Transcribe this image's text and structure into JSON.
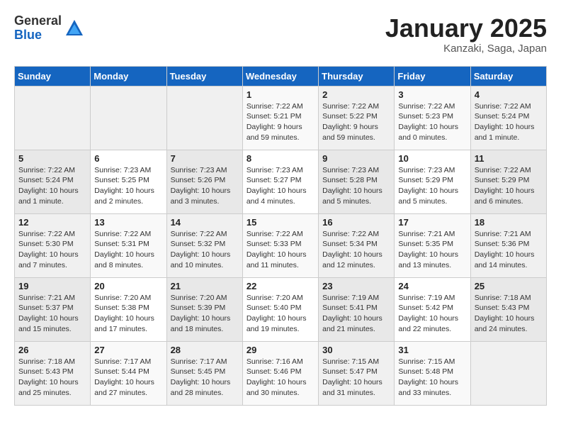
{
  "header": {
    "logo_general": "General",
    "logo_blue": "Blue",
    "title": "January 2025",
    "location": "Kanzaki, Saga, Japan"
  },
  "weekdays": [
    "Sunday",
    "Monday",
    "Tuesday",
    "Wednesday",
    "Thursday",
    "Friday",
    "Saturday"
  ],
  "weeks": [
    [
      {
        "num": "",
        "info": ""
      },
      {
        "num": "",
        "info": ""
      },
      {
        "num": "",
        "info": ""
      },
      {
        "num": "1",
        "info": "Sunrise: 7:22 AM\nSunset: 5:21 PM\nDaylight: 9 hours\nand 59 minutes."
      },
      {
        "num": "2",
        "info": "Sunrise: 7:22 AM\nSunset: 5:22 PM\nDaylight: 9 hours\nand 59 minutes."
      },
      {
        "num": "3",
        "info": "Sunrise: 7:22 AM\nSunset: 5:23 PM\nDaylight: 10 hours\nand 0 minutes."
      },
      {
        "num": "4",
        "info": "Sunrise: 7:22 AM\nSunset: 5:24 PM\nDaylight: 10 hours\nand 1 minute."
      }
    ],
    [
      {
        "num": "5",
        "info": "Sunrise: 7:22 AM\nSunset: 5:24 PM\nDaylight: 10 hours\nand 1 minute."
      },
      {
        "num": "6",
        "info": "Sunrise: 7:23 AM\nSunset: 5:25 PM\nDaylight: 10 hours\nand 2 minutes."
      },
      {
        "num": "7",
        "info": "Sunrise: 7:23 AM\nSunset: 5:26 PM\nDaylight: 10 hours\nand 3 minutes."
      },
      {
        "num": "8",
        "info": "Sunrise: 7:23 AM\nSunset: 5:27 PM\nDaylight: 10 hours\nand 4 minutes."
      },
      {
        "num": "9",
        "info": "Sunrise: 7:23 AM\nSunset: 5:28 PM\nDaylight: 10 hours\nand 5 minutes."
      },
      {
        "num": "10",
        "info": "Sunrise: 7:23 AM\nSunset: 5:29 PM\nDaylight: 10 hours\nand 5 minutes."
      },
      {
        "num": "11",
        "info": "Sunrise: 7:22 AM\nSunset: 5:29 PM\nDaylight: 10 hours\nand 6 minutes."
      }
    ],
    [
      {
        "num": "12",
        "info": "Sunrise: 7:22 AM\nSunset: 5:30 PM\nDaylight: 10 hours\nand 7 minutes."
      },
      {
        "num": "13",
        "info": "Sunrise: 7:22 AM\nSunset: 5:31 PM\nDaylight: 10 hours\nand 8 minutes."
      },
      {
        "num": "14",
        "info": "Sunrise: 7:22 AM\nSunset: 5:32 PM\nDaylight: 10 hours\nand 10 minutes."
      },
      {
        "num": "15",
        "info": "Sunrise: 7:22 AM\nSunset: 5:33 PM\nDaylight: 10 hours\nand 11 minutes."
      },
      {
        "num": "16",
        "info": "Sunrise: 7:22 AM\nSunset: 5:34 PM\nDaylight: 10 hours\nand 12 minutes."
      },
      {
        "num": "17",
        "info": "Sunrise: 7:21 AM\nSunset: 5:35 PM\nDaylight: 10 hours\nand 13 minutes."
      },
      {
        "num": "18",
        "info": "Sunrise: 7:21 AM\nSunset: 5:36 PM\nDaylight: 10 hours\nand 14 minutes."
      }
    ],
    [
      {
        "num": "19",
        "info": "Sunrise: 7:21 AM\nSunset: 5:37 PM\nDaylight: 10 hours\nand 15 minutes."
      },
      {
        "num": "20",
        "info": "Sunrise: 7:20 AM\nSunset: 5:38 PM\nDaylight: 10 hours\nand 17 minutes."
      },
      {
        "num": "21",
        "info": "Sunrise: 7:20 AM\nSunset: 5:39 PM\nDaylight: 10 hours\nand 18 minutes."
      },
      {
        "num": "22",
        "info": "Sunrise: 7:20 AM\nSunset: 5:40 PM\nDaylight: 10 hours\nand 19 minutes."
      },
      {
        "num": "23",
        "info": "Sunrise: 7:19 AM\nSunset: 5:41 PM\nDaylight: 10 hours\nand 21 minutes."
      },
      {
        "num": "24",
        "info": "Sunrise: 7:19 AM\nSunset: 5:42 PM\nDaylight: 10 hours\nand 22 minutes."
      },
      {
        "num": "25",
        "info": "Sunrise: 7:18 AM\nSunset: 5:43 PM\nDaylight: 10 hours\nand 24 minutes."
      }
    ],
    [
      {
        "num": "26",
        "info": "Sunrise: 7:18 AM\nSunset: 5:43 PM\nDaylight: 10 hours\nand 25 minutes."
      },
      {
        "num": "27",
        "info": "Sunrise: 7:17 AM\nSunset: 5:44 PM\nDaylight: 10 hours\nand 27 minutes."
      },
      {
        "num": "28",
        "info": "Sunrise: 7:17 AM\nSunset: 5:45 PM\nDaylight: 10 hours\nand 28 minutes."
      },
      {
        "num": "29",
        "info": "Sunrise: 7:16 AM\nSunset: 5:46 PM\nDaylight: 10 hours\nand 30 minutes."
      },
      {
        "num": "30",
        "info": "Sunrise: 7:15 AM\nSunset: 5:47 PM\nDaylight: 10 hours\nand 31 minutes."
      },
      {
        "num": "31",
        "info": "Sunrise: 7:15 AM\nSunset: 5:48 PM\nDaylight: 10 hours\nand 33 minutes."
      },
      {
        "num": "",
        "info": ""
      }
    ]
  ]
}
